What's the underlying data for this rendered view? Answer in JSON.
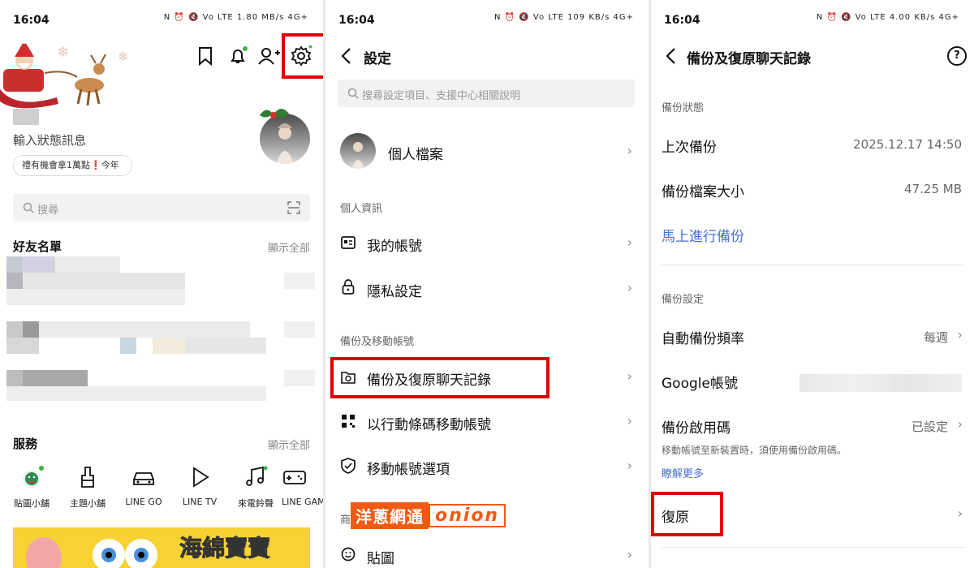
{
  "status": {
    "time": "16:04",
    "icons_1": "N ⏰ 🔇 Vo LTE 1.80 MB/s 4G+",
    "icons_2": "N ⏰ 🔇 Vo LTE 109 KB/s 4G+",
    "icons_3": "N ⏰ 🔇 Vo LTE 4.00 KB/s 4G+"
  },
  "home": {
    "status_message": "輸入狀態訊息",
    "promo_chip": "禮有機會拿1萬點❗今年",
    "search_placeholder": "搜尋",
    "friends_title": "好友名單",
    "friends_show_all": "顯示全部",
    "services_title": "服務",
    "services_show_all": "顯示全部",
    "services": [
      {
        "label": "貼圖小舖"
      },
      {
        "label": "主題小舖"
      },
      {
        "label": "LINE GO"
      },
      {
        "label": "LINE TV"
      },
      {
        "label": "來電鈴聲"
      },
      {
        "label": "LINE GAME"
      }
    ],
    "banner_text": "海綿寶寶"
  },
  "settings": {
    "title": "設定",
    "search_placeholder": "搜尋設定項目、支援中心相關說明",
    "profile_label": "個人檔案",
    "section_personal": "個人資訊",
    "my_account": "我的帳號",
    "privacy": "隱私設定",
    "section_backup": "備份及移動帳號",
    "backup_restore": "備份及復原聊天記錄",
    "qr_move": "以行動條碼移動帳號",
    "move_options": "移動帳號選項",
    "section_shop": "商",
    "stickers": "貼圖",
    "watermark_cn": "洋蔥網通",
    "watermark_en": "onion"
  },
  "backup": {
    "title": "備份及復原聊天記錄",
    "section_status": "備份狀態",
    "last_backup_label": "上次備份",
    "last_backup_value": "2025.12.17 14:50",
    "file_size_label": "備份檔案大小",
    "file_size_value": "47.25 MB",
    "backup_now": "馬上進行備份",
    "section_settings": "備份設定",
    "auto_freq_label": "自動備份頻率",
    "auto_freq_value": "每週",
    "google_label": "Google帳號",
    "pin_label": "備份啟用碼",
    "pin_value": "已設定",
    "pin_hint": "移動帳號至新裝置時，須使用備份啟用碼。",
    "learn_more": "瞭解更多",
    "restore": "復原"
  },
  "colors": {
    "red_highlight": "#e00000",
    "link_blue": "#4a6fd1",
    "online_dot": "#38b24a"
  }
}
